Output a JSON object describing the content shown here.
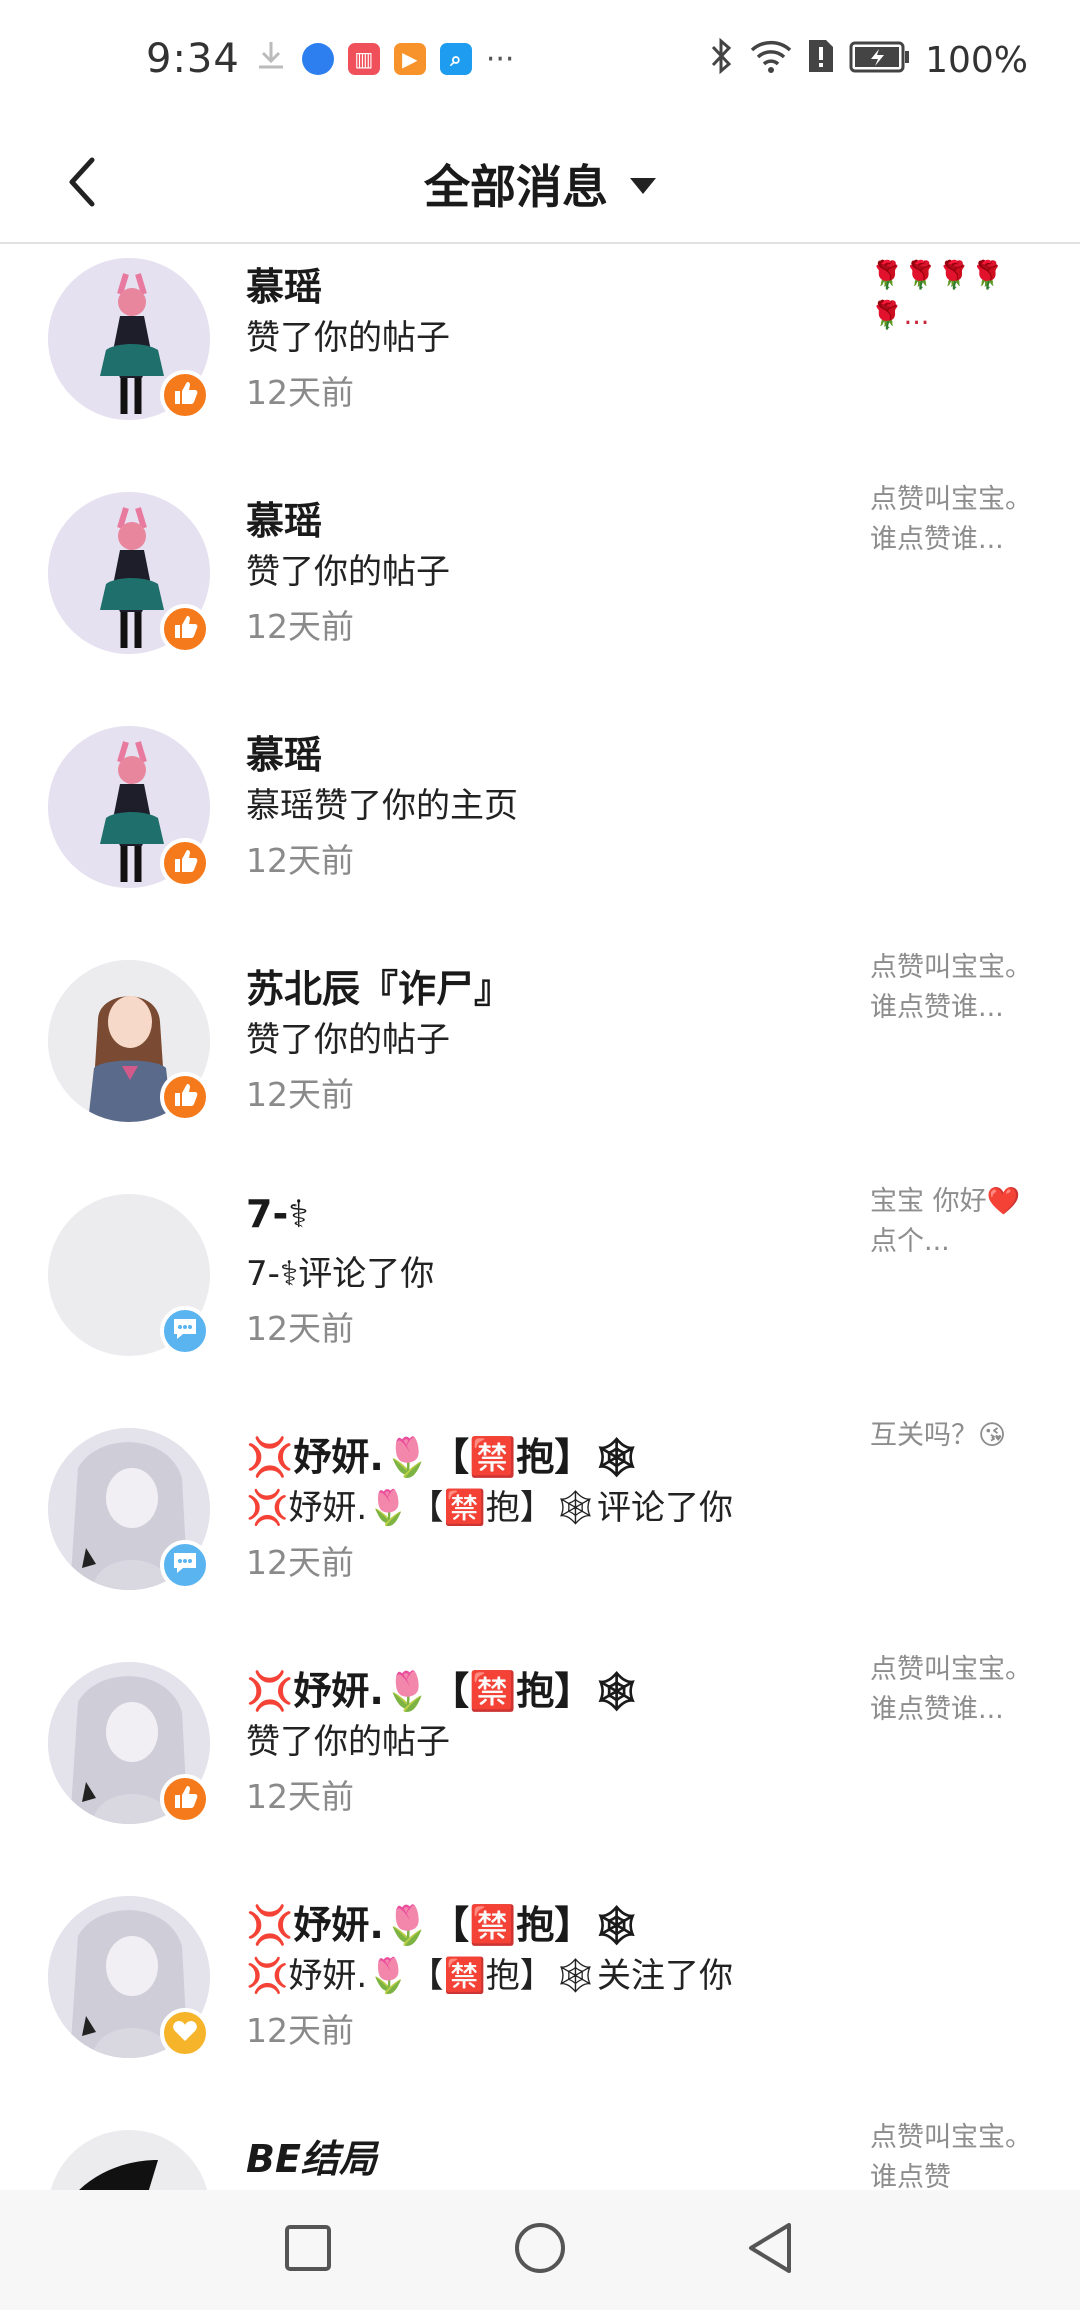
{
  "status_bar": {
    "time": "9:34",
    "more": "···",
    "battery": "100%",
    "icons": [
      "download-icon",
      "browser-icon",
      "reader-icon",
      "video-icon",
      "search-app-icon",
      "bluetooth-icon",
      "wifi-icon",
      "sim-icon",
      "battery-icon"
    ]
  },
  "header": {
    "title": "全部消息",
    "back_icon": "chevron-left-icon",
    "dropdown_icon": "caret-down-icon"
  },
  "messages": [
    {
      "name": "慕瑶",
      "action": "赞了你的帖子",
      "time": "12天前",
      "preview": "🌹🌹🌹🌹🌹...",
      "badge": "like"
    },
    {
      "name": "慕瑶",
      "action": "赞了你的帖子",
      "time": "12天前",
      "preview": "点赞叫宝宝。谁点赞谁...",
      "badge": "like"
    },
    {
      "name": "慕瑶",
      "action": "慕瑶赞了你的主页",
      "time": "12天前",
      "preview": "",
      "badge": "like"
    },
    {
      "name": "苏北辰『诈尸』",
      "action": "赞了你的帖子",
      "time": "12天前",
      "preview": "点赞叫宝宝。谁点赞谁...",
      "badge": "like"
    },
    {
      "name": "7-⚕",
      "action": "7-⚕评论了你",
      "time": "12天前",
      "preview": "宝宝 你好❤️点个...",
      "badge": "comment"
    },
    {
      "name": "💢妤妍.🌷【🈲抱】🕸",
      "action": "💢妤妍.🌷【🈲抱】🕸评论了你",
      "time": "12天前",
      "preview": "互关吗？😘",
      "badge": "comment"
    },
    {
      "name": "💢妤妍.🌷【🈲抱】🕸",
      "action": "赞了你的帖子",
      "time": "12天前",
      "preview": "点赞叫宝宝。谁点赞谁...",
      "badge": "like"
    },
    {
      "name": "💢妤妍.🌷【🈲抱】🕸",
      "action": "💢妤妍.🌷【🈲抱】🕸关注了你",
      "time": "12天前",
      "preview": "",
      "badge": "follow"
    },
    {
      "name": "BE结局",
      "action": "",
      "time": "",
      "preview": "点赞叫宝宝。谁点赞",
      "badge": ""
    }
  ],
  "nav_bar": {
    "icons": [
      "recents-square-icon",
      "home-circle-icon",
      "back-triangle-icon"
    ]
  }
}
